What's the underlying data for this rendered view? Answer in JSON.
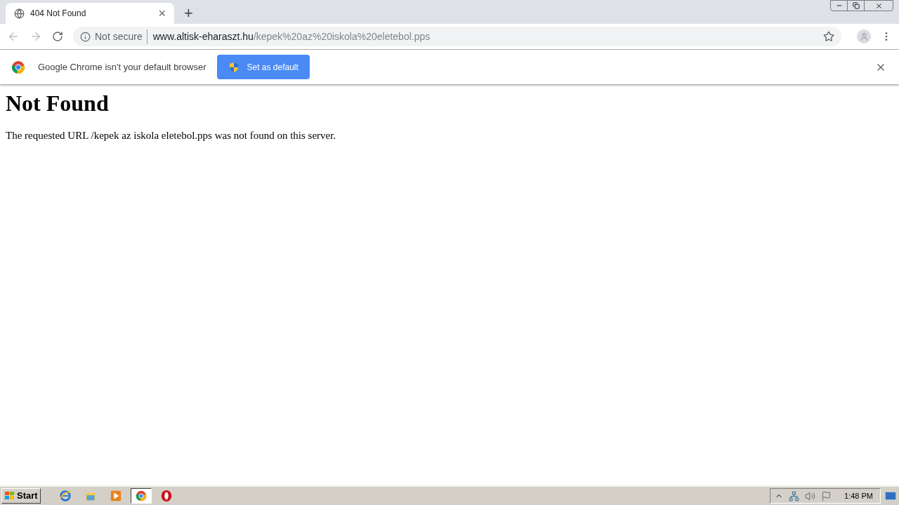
{
  "tab": {
    "title": "404 Not Found",
    "close": "×"
  },
  "new_tab": "+",
  "address_bar": {
    "security": "Not secure",
    "host": "www.altisk-eharaszt.hu",
    "path": "/kepek%20az%20iskola%20eletebol.pps"
  },
  "infobar": {
    "message": "Google Chrome isn't your default browser",
    "button": "Set as default"
  },
  "page": {
    "heading": "Not Found",
    "body": "The requested URL /kepek az iskola eletebol.pps was not found on this server."
  },
  "taskbar": {
    "start": "Start",
    "apps": [
      {
        "kind": "ie",
        "selected": false
      },
      {
        "kind": "explorer",
        "selected": false
      },
      {
        "kind": "media",
        "selected": false
      },
      {
        "kind": "chrome",
        "selected": true
      },
      {
        "kind": "opera",
        "selected": false
      }
    ],
    "clock": "1:48 PM"
  }
}
